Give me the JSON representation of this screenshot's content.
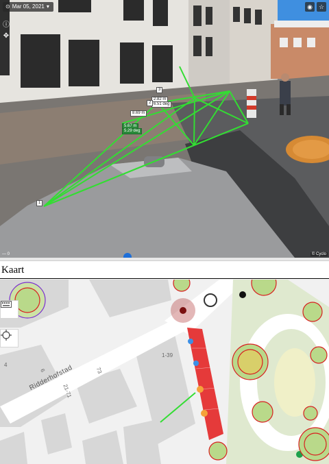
{
  "panorama": {
    "capture_date": "Mar 05, 2021",
    "measure_labels": [
      "2.82 m",
      "6.51 deg",
      "8.69 m",
      "5.67 m",
      "5.29 deg"
    ],
    "point_labels": [
      "1",
      "2",
      "3"
    ],
    "corner_left": "— 0",
    "corner_right": "© Cyclo"
  },
  "map": {
    "title": "Kaart",
    "street_name": "Ridderhofstad",
    "house_numbers": [
      "1-39",
      "73",
      "21-71",
      "6",
      "4"
    ],
    "colors": {
      "building": "#d7d7d7",
      "selection": "#e53a3a",
      "tree_ring": "#d81f1f",
      "tree_fill": "#b9d98a",
      "measure_line": "#33dd33"
    }
  }
}
